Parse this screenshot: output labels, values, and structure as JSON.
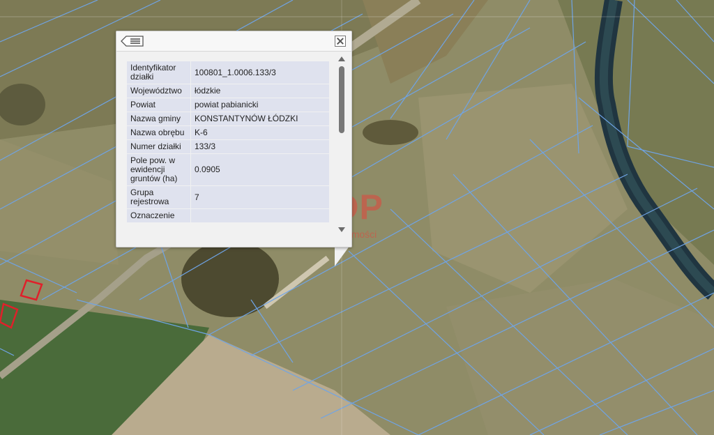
{
  "popup": {
    "menu_icon": "list-menu-icon",
    "close_icon": "close-icon",
    "rows": [
      {
        "label": "Identyfikator działki",
        "value": "100801_1.0006.133/3"
      },
      {
        "label": "Województwo",
        "value": "łódzkie"
      },
      {
        "label": "Powiat",
        "value": "powiat pabianicki"
      },
      {
        "label": "Nazwa gminy",
        "value": "KONSTANTYNÓW ŁÓDZKI"
      },
      {
        "label": "Nazwa obrębu",
        "value": "K-6"
      },
      {
        "label": "Numer działki",
        "value": "133/3"
      },
      {
        "label": "Pole pow. w ewidencji gruntów (ha)",
        "value": "0.0905"
      },
      {
        "label": "Grupa rejestrowa",
        "value": "7"
      },
      {
        "label": "Oznaczenie",
        "value": ""
      }
    ]
  },
  "watermark": {
    "main": "SDP",
    "sub": "nieruchomości"
  },
  "colors": {
    "parcel_lines": "#6fa4e6",
    "building_outline": "#e0202a"
  }
}
